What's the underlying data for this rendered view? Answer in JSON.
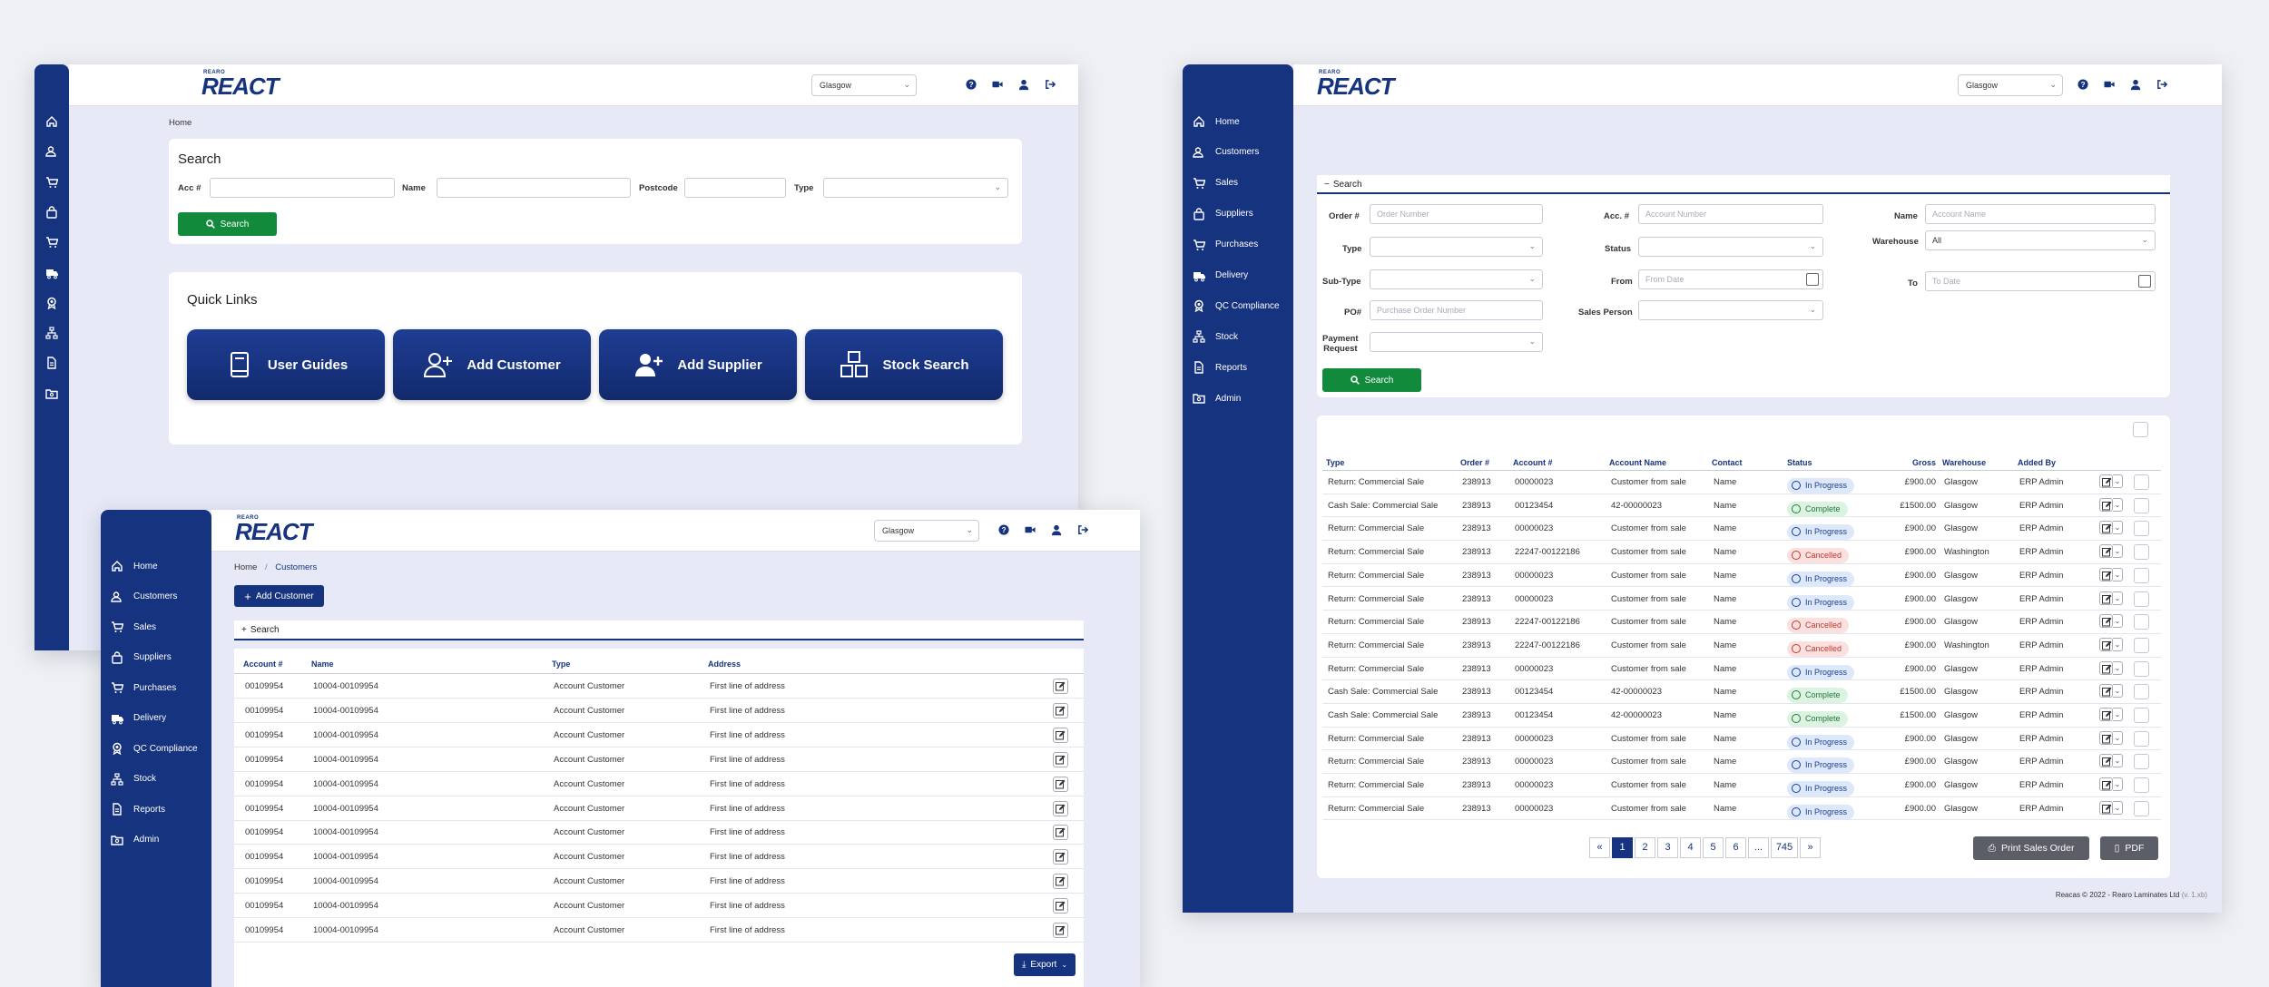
{
  "common": {
    "brand_small": "REARO",
    "brand": "REACT",
    "location": "Glasgow",
    "nav": [
      "Home",
      "Customers",
      "Sales",
      "Suppliers",
      "Purchases",
      "Delivery",
      "QC Compliance",
      "Stock",
      "Reports",
      "Admin"
    ],
    "nav_icons": [
      "home-icon",
      "users-icon",
      "cart-icon",
      "bag-icon",
      "cart-plus-icon",
      "truck-icon",
      "award-icon",
      "sitemap-icon",
      "file-icon",
      "folder-icon"
    ],
    "top_icons": [
      "help-icon",
      "video-icon",
      "user-icon",
      "logout-icon"
    ]
  },
  "home": {
    "breadcrumb": "Home",
    "search": {
      "title": "Search",
      "acc_label": "Acc #",
      "name_label": "Name",
      "postcode_label": "Postcode",
      "type_label": "Type",
      "button": "Search"
    },
    "quick_links": {
      "title": "Quick Links",
      "items": [
        "User Guides",
        "Add Customer",
        "Add Supplier",
        "Stock Search"
      ]
    }
  },
  "customers": {
    "breadcrumb_home": "Home",
    "breadcrumb_sep": "/",
    "breadcrumb_current": "Customers",
    "add_button": "Add Customer",
    "search_toggle": "Search",
    "columns": [
      "Account #",
      "Name",
      "Type",
      "Address"
    ],
    "rows": [
      [
        "00109954",
        "10004-00109954",
        "Account Customer",
        "First line of address"
      ],
      [
        "00109954",
        "10004-00109954",
        "Account Customer",
        "First line of address"
      ],
      [
        "00109954",
        "10004-00109954",
        "Account Customer",
        "First line of address"
      ],
      [
        "00109954",
        "10004-00109954",
        "Account Customer",
        "First line of address"
      ],
      [
        "00109954",
        "10004-00109954",
        "Account Customer",
        "First line of address"
      ],
      [
        "00109954",
        "10004-00109954",
        "Account Customer",
        "First line of address"
      ],
      [
        "00109954",
        "10004-00109954",
        "Account Customer",
        "First line of address"
      ],
      [
        "00109954",
        "10004-00109954",
        "Account Customer",
        "First line of address"
      ],
      [
        "00109954",
        "10004-00109954",
        "Account Customer",
        "First line of address"
      ],
      [
        "00109954",
        "10004-00109954",
        "Account Customer",
        "First line of address"
      ],
      [
        "00109954",
        "10004-00109954",
        "Account Customer",
        "First line of address"
      ]
    ],
    "export": "Export"
  },
  "sales": {
    "search_header": "Search",
    "fields": {
      "order_label": "Order #",
      "order_ph": "Order Number",
      "acc_label": "Acc. #",
      "acc_ph": "Account Number",
      "name_label": "Name",
      "name_ph": "Account Name",
      "type_label": "Type",
      "status_label": "Status",
      "warehouse_label": "Warehouse",
      "warehouse_value": "All",
      "subtype_label": "Sub-Type",
      "from_label": "From",
      "from_ph": "From Date",
      "to_label": "To",
      "to_ph": "To Date",
      "po_label": "PO#",
      "po_ph": "Purchase Order Number",
      "salesperson_label": "Sales Person",
      "payment_label_1": "Payment",
      "payment_label_2": "Request"
    },
    "search_button": "Search",
    "columns": [
      "Type",
      "Order #",
      "Account #",
      "Account Name",
      "Contact",
      "Status",
      "Gross",
      "Warehouse",
      "Added By"
    ],
    "rows": [
      [
        "Return: Commercial Sale",
        "238913",
        "00000023",
        "Customer from sale",
        "Name",
        "In Progress",
        "£900.00",
        "Glasgow",
        "ERP Admin"
      ],
      [
        "Cash Sale: Commercial Sale",
        "238913",
        "00123454",
        "42-00000023",
        "Name",
        "Complete",
        "£1500.00",
        "Glasgow",
        "ERP Admin"
      ],
      [
        "Return: Commercial Sale",
        "238913",
        "00000023",
        "Customer from sale",
        "Name",
        "In Progress",
        "£900.00",
        "Glasgow",
        "ERP Admin"
      ],
      [
        "Return: Commercial Sale",
        "238913",
        "22247-00122186",
        "Customer from sale",
        "Name",
        "Cancelled",
        "£900.00",
        "Washington",
        "ERP Admin"
      ],
      [
        "Return: Commercial Sale",
        "238913",
        "00000023",
        "Customer from sale",
        "Name",
        "In Progress",
        "£900.00",
        "Glasgow",
        "ERP Admin"
      ],
      [
        "Return: Commercial Sale",
        "238913",
        "00000023",
        "Customer from sale",
        "Name",
        "In Progress",
        "£900.00",
        "Glasgow",
        "ERP Admin"
      ],
      [
        "Return: Commercial Sale",
        "238913",
        "22247-00122186",
        "Customer from sale",
        "Name",
        "Cancelled",
        "£900.00",
        "Glasgow",
        "ERP Admin"
      ],
      [
        "Return: Commercial Sale",
        "238913",
        "22247-00122186",
        "Customer from sale",
        "Name",
        "Cancelled",
        "£900.00",
        "Washington",
        "ERP Admin"
      ],
      [
        "Return: Commercial Sale",
        "238913",
        "00000023",
        "Customer from sale",
        "Name",
        "In Progress",
        "£900.00",
        "Glasgow",
        "ERP Admin"
      ],
      [
        "Cash Sale: Commercial Sale",
        "238913",
        "00123454",
        "42-00000023",
        "Name",
        "Complete",
        "£1500.00",
        "Glasgow",
        "ERP Admin"
      ],
      [
        "Cash Sale: Commercial Sale",
        "238913",
        "00123454",
        "42-00000023",
        "Name",
        "Complete",
        "£1500.00",
        "Glasgow",
        "ERP Admin"
      ],
      [
        "Return: Commercial Sale",
        "238913",
        "00000023",
        "Customer from sale",
        "Name",
        "In Progress",
        "£900.00",
        "Glasgow",
        "ERP Admin"
      ],
      [
        "Return: Commercial Sale",
        "238913",
        "00000023",
        "Customer from sale",
        "Name",
        "In Progress",
        "£900.00",
        "Glasgow",
        "ERP Admin"
      ],
      [
        "Return: Commercial Sale",
        "238913",
        "00000023",
        "Customer from sale",
        "Name",
        "In Progress",
        "£900.00",
        "Glasgow",
        "ERP Admin"
      ],
      [
        "Return: Commercial Sale",
        "238913",
        "00000023",
        "Customer from sale",
        "Name",
        "In Progress",
        "£900.00",
        "Glasgow",
        "ERP Admin"
      ]
    ],
    "pagination": [
      "«",
      "1",
      "2",
      "3",
      "4",
      "5",
      "6",
      "...",
      "745",
      "»"
    ],
    "print_button": "Print Sales Order",
    "pdf_button": "PDF",
    "footer": "Reacas © 2022 - Rearo Laminates Ltd",
    "footer_version": "(v. 1.xb)"
  }
}
